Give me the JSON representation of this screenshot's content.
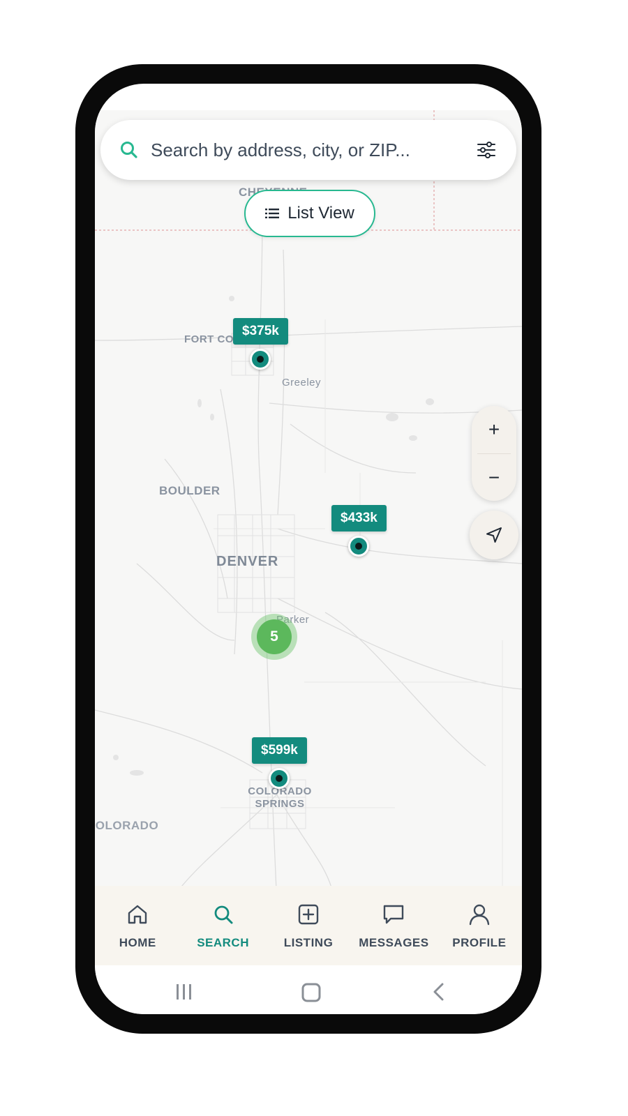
{
  "search": {
    "placeholder": "Search by address, city, or ZIP...",
    "icon": "search-icon",
    "filter_icon": "sliders-icon"
  },
  "list_view": {
    "label": "List View",
    "icon": "list-icon"
  },
  "map": {
    "places": {
      "cheyenne": "CHEYENNE",
      "fort_collins": "FORT COLLINS",
      "greeley": "Greeley",
      "boulder": "BOULDER",
      "denver": "DENVER",
      "parker": "Parker",
      "colorado_springs_line1": "COLORADO",
      "colorado_springs_line2": "SPRINGS",
      "colorado": "COLORADO"
    },
    "markers": [
      {
        "price": "$375k"
      },
      {
        "price": "$433k"
      },
      {
        "price": "$599k"
      }
    ],
    "cluster": {
      "count": "5"
    },
    "controls": {
      "zoom_in": "+",
      "zoom_out": "−",
      "locate_icon": "navigation-arrow-icon"
    }
  },
  "tabbar": {
    "items": [
      {
        "label": "HOME",
        "icon": "home-icon",
        "active": false
      },
      {
        "label": "SEARCH",
        "icon": "search-icon",
        "active": true
      },
      {
        "label": "LISTING",
        "icon": "plus-square-icon",
        "active": false
      },
      {
        "label": "MESSAGES",
        "icon": "message-icon",
        "active": false
      },
      {
        "label": "PROFILE",
        "icon": "user-icon",
        "active": false
      }
    ]
  },
  "system_nav": {
    "recents_icon": "recents-icon",
    "home_icon": "home-button-icon",
    "back_icon": "back-icon"
  },
  "colors": {
    "accent": "#138b7e",
    "accent_border": "#27b890",
    "cluster": "#5cb85c",
    "text": "#3f4b5a"
  }
}
